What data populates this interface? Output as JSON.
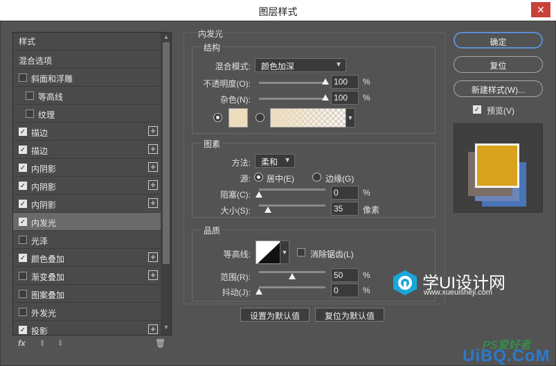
{
  "window": {
    "title": "图层样式",
    "close_glyph": "✕"
  },
  "styles_list": {
    "header": "样式",
    "items": [
      {
        "label": "混合选项",
        "checkbox": null,
        "checked": false,
        "plus": false,
        "indent": 0,
        "selected": false
      },
      {
        "label": "斜面和浮雕",
        "checkbox": true,
        "checked": false,
        "plus": false,
        "indent": 0,
        "selected": false
      },
      {
        "label": "等高线",
        "checkbox": true,
        "checked": false,
        "plus": false,
        "indent": 1,
        "selected": false
      },
      {
        "label": "纹理",
        "checkbox": true,
        "checked": false,
        "plus": false,
        "indent": 1,
        "selected": false
      },
      {
        "label": "描边",
        "checkbox": true,
        "checked": true,
        "plus": true,
        "indent": 0,
        "selected": false
      },
      {
        "label": "描边",
        "checkbox": true,
        "checked": true,
        "plus": true,
        "indent": 0,
        "selected": false
      },
      {
        "label": "内阴影",
        "checkbox": true,
        "checked": true,
        "plus": true,
        "indent": 0,
        "selected": false
      },
      {
        "label": "内阴影",
        "checkbox": true,
        "checked": true,
        "plus": true,
        "indent": 0,
        "selected": false
      },
      {
        "label": "内阴影",
        "checkbox": true,
        "checked": true,
        "plus": true,
        "indent": 0,
        "selected": false
      },
      {
        "label": "内发光",
        "checkbox": true,
        "checked": true,
        "plus": false,
        "indent": 0,
        "selected": true
      },
      {
        "label": "光泽",
        "checkbox": true,
        "checked": false,
        "plus": false,
        "indent": 0,
        "selected": false
      },
      {
        "label": "颜色叠加",
        "checkbox": true,
        "checked": true,
        "plus": true,
        "indent": 0,
        "selected": false
      },
      {
        "label": "渐变叠加",
        "checkbox": true,
        "checked": false,
        "plus": true,
        "indent": 0,
        "selected": false
      },
      {
        "label": "图案叠加",
        "checkbox": true,
        "checked": false,
        "plus": false,
        "indent": 0,
        "selected": false
      },
      {
        "label": "外发光",
        "checkbox": true,
        "checked": false,
        "plus": false,
        "indent": 0,
        "selected": false
      },
      {
        "label": "投影",
        "checkbox": true,
        "checked": true,
        "plus": true,
        "indent": 0,
        "selected": false
      }
    ],
    "tools": {
      "fx": "fx",
      "up": "⬆",
      "down": "⬇",
      "trash": "🗑"
    }
  },
  "inner_glow": {
    "section_title": "内发光",
    "structure": {
      "title": "结构",
      "blend_mode_label": "混合模式:",
      "blend_mode_value": "颜色加深",
      "opacity_label": "不透明度(O):",
      "opacity_value": "100",
      "opacity_pct": 100,
      "noise_label": "杂色(N):",
      "noise_value": "100",
      "noise_pct": 100,
      "percent": "%",
      "glow_color": "#ecdcbd"
    },
    "elements": {
      "title": "图素",
      "method_label": "方法:",
      "method_value": "柔和",
      "source_label": "源:",
      "source_center": "居中(E)",
      "source_edge": "边缘(G)",
      "choke_label": "阻塞(C):",
      "choke_value": "0",
      "choke_pct": 0,
      "size_label": "大小(S):",
      "size_value": "35",
      "size_pct": 14,
      "pixel_unit": "像素",
      "percent": "%"
    },
    "quality": {
      "title": "品质",
      "contour_label": "等高线:",
      "antialias_label": "消除锯齿(L)",
      "range_label": "范围(R):",
      "range_value": "50",
      "range_pct": 50,
      "jitter_label": "抖动(J):",
      "jitter_value": "0",
      "jitter_pct": 0,
      "percent": "%"
    },
    "set_default": "设置为默认值",
    "reset_default": "复位为默认值"
  },
  "actions": {
    "ok": "确定",
    "reset": "复位",
    "new_style": "新建样式(W)...",
    "preview_label": "预览(V)",
    "preview_checked": true
  },
  "watermark": {
    "brand": "学UI设计网",
    "url": "www.xueuisheji.com",
    "ps_text": "PS爱好者",
    "uibq": "UiBQ.CoM"
  },
  "colors": {
    "accent": "#5b8fd6",
    "preview_gold": "#d8a21c",
    "preview_blue": "#4a74b8"
  }
}
